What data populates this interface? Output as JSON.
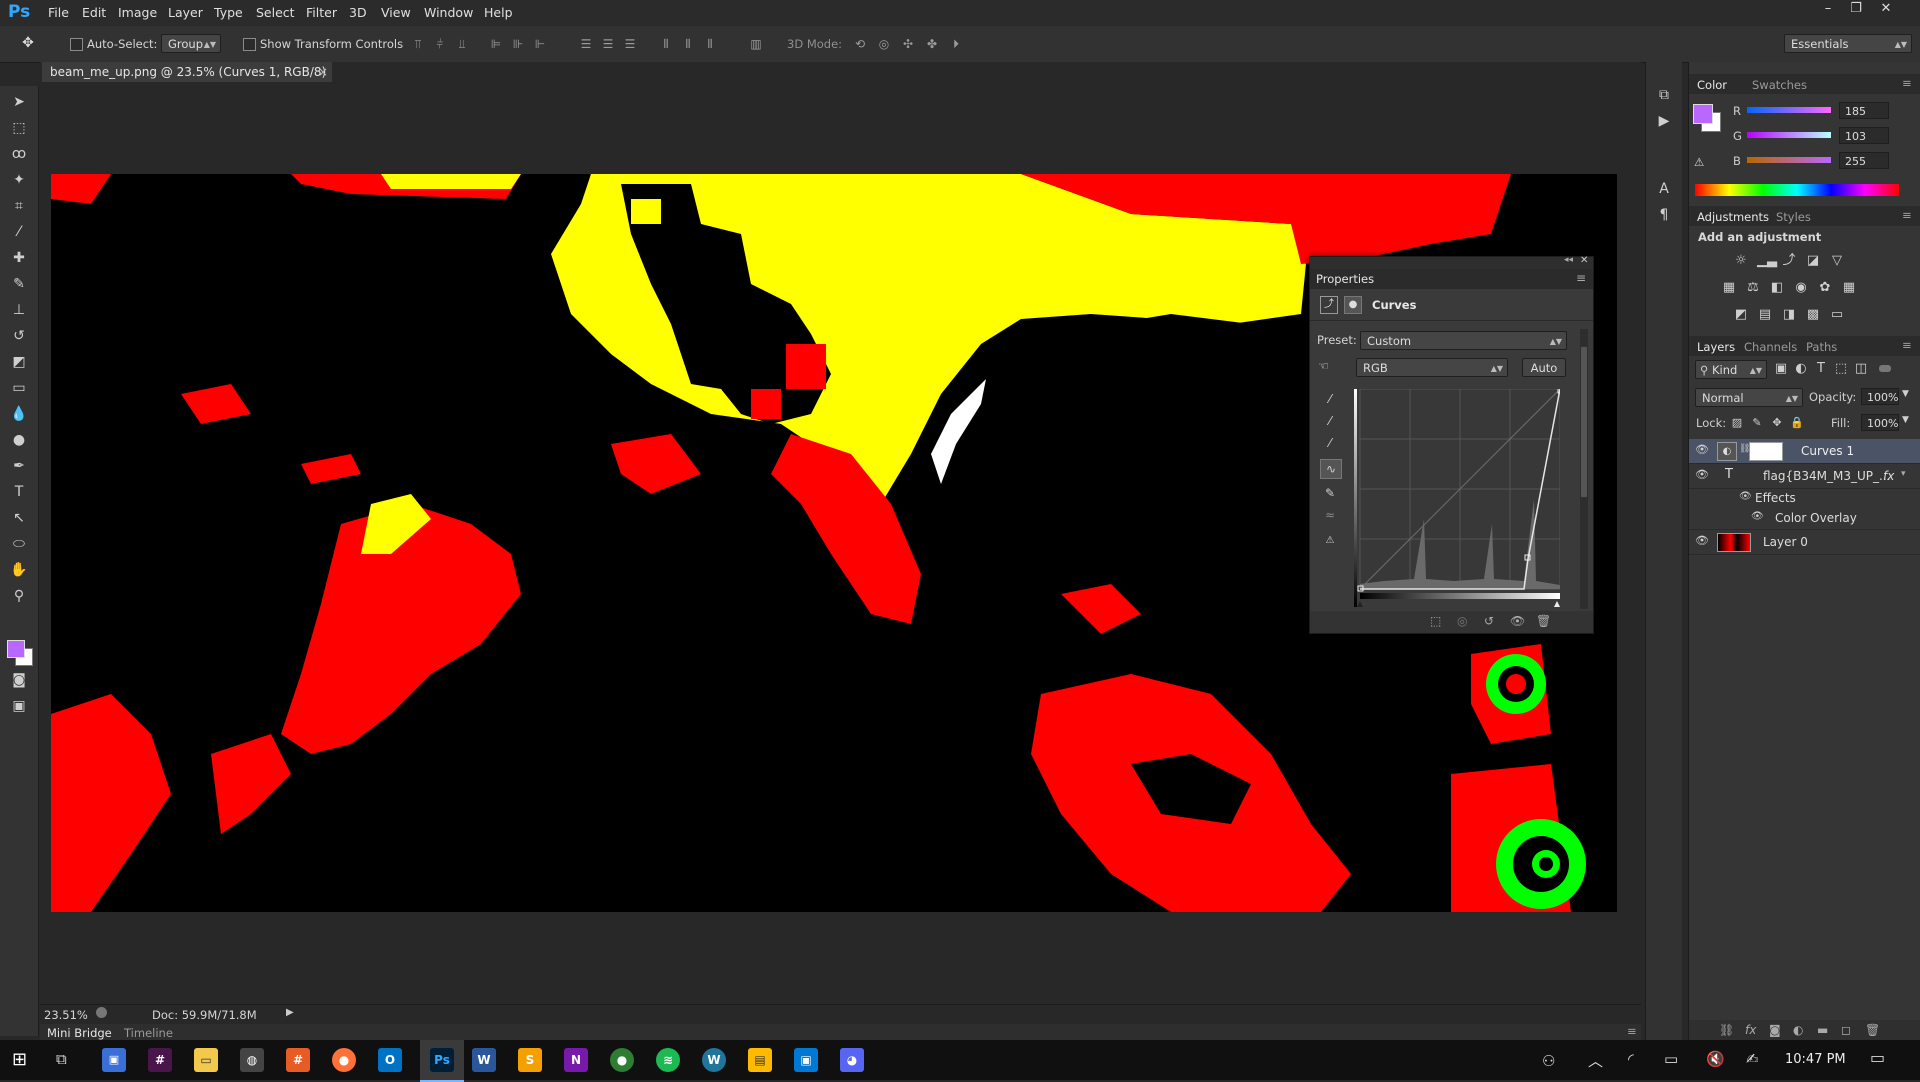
{
  "app": {
    "name": "Ps"
  },
  "menu": [
    "File",
    "Edit",
    "Image",
    "Layer",
    "Type",
    "Select",
    "Filter",
    "3D",
    "View",
    "Window",
    "Help"
  ],
  "window_controls": {
    "minimize": "–",
    "restore": "❐",
    "close": "✕"
  },
  "options_bar": {
    "auto_select_label": "Auto-Select:",
    "auto_select_value": "Group",
    "show_transform_label": "Show Transform Controls",
    "mode_3d_label": "3D Mode:",
    "workspace": "Essentials"
  },
  "document": {
    "tab_title": "beam_me_up.png @ 23.5% (Curves 1, RGB/8) *",
    "close": "×"
  },
  "status": {
    "zoom": "23.51%",
    "doc": "Doc: 59.9M/71.8M"
  },
  "bottom_tabs": [
    "Mini Bridge",
    "Timeline"
  ],
  "color_panel": {
    "tabs": [
      "Color",
      "Swatches"
    ],
    "foreground": "#b967ff",
    "channels": [
      {
        "label": "R",
        "value": "185"
      },
      {
        "label": "G",
        "value": "103"
      },
      {
        "label": "B",
        "value": "255"
      }
    ]
  },
  "adjustments_panel": {
    "tabs": [
      "Adjustments",
      "Styles"
    ],
    "heading": "Add an adjustment"
  },
  "layers_panel": {
    "tabs": [
      "Layers",
      "Channels",
      "Paths"
    ],
    "filter": "Kind",
    "blend_mode": "Normal",
    "opacity_label": "Opacity:",
    "opacity": "100%",
    "lock_label": "Lock:",
    "fill_label": "Fill:",
    "fill": "100%",
    "layers": [
      {
        "name": "Curves 1",
        "type": "adjustment",
        "selected": true
      },
      {
        "name": "flag{B34M_M3_UP_...",
        "type": "text",
        "fx": "fx"
      },
      {
        "name": "Effects",
        "type": "effects-group"
      },
      {
        "name": "Color Overlay",
        "type": "effect"
      },
      {
        "name": "Layer 0",
        "type": "image"
      }
    ]
  },
  "properties_panel": {
    "title": "Properties",
    "subtitle": "Curves",
    "preset_label": "Preset:",
    "preset_value": "Custom",
    "channel": "RGB",
    "auto_label": "Auto"
  },
  "taskbar": {
    "time": "10:47 PM",
    "apps": [
      "Ps",
      "W",
      "N"
    ]
  }
}
